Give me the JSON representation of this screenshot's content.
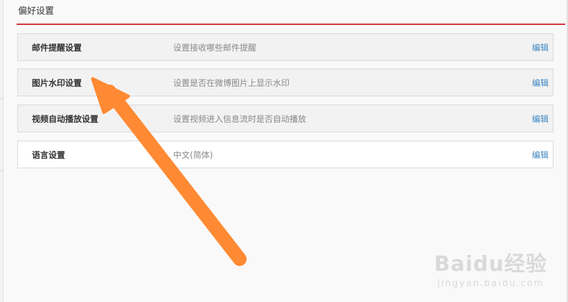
{
  "page": {
    "title": "偏好设置"
  },
  "settings": [
    {
      "name": "邮件提醒设置",
      "description": "设置接收哪些邮件提醒",
      "action": "编辑"
    },
    {
      "name": "图片水印设置",
      "description": "设置是否在微博图片上显示水印",
      "action": "编辑"
    },
    {
      "name": "视频自动播放设置",
      "description": "设置视频进入信息流时是否自动播放",
      "action": "编辑"
    },
    {
      "name": "语言设置",
      "description": "中文(简体)",
      "action": "编辑"
    }
  ],
  "watermark": {
    "brand": "Baidu经验",
    "url": "jingyan.baidu.com"
  },
  "colors": {
    "accent_rule": "#d1333a",
    "link": "#3d87c2",
    "arrow": "#ff8a33"
  }
}
